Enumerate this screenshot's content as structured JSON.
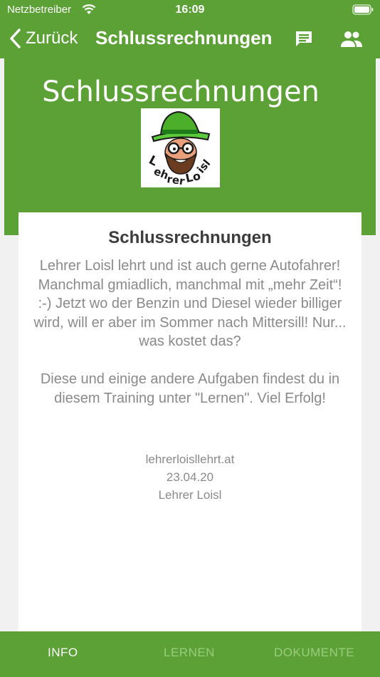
{
  "status_bar": {
    "carrier": "Netzbetreiber",
    "time": "16:09",
    "wifi_icon": "wifi-icon",
    "battery_icon": "battery-icon"
  },
  "nav": {
    "back_label": "Zurück",
    "title": "Schlussrechnungen",
    "icons": [
      "chevron-left-icon",
      "chat-icon",
      "people-icon"
    ]
  },
  "banner": {
    "title": "Schlussrechnungen",
    "logo_text": "Lehrer Loisl"
  },
  "card": {
    "title": "Schlussrechnungen",
    "body": "Lehrer Loisl lehrt und ist auch gerne Autofahrer! Manchmal gmiadlich, manchmal mit „mehr Zeit“! :-) Jetzt wo der Benzin und Diesel wieder billiger wird, will er aber im Sommer nach Mittersill! Nur... was kostet das?\n\nDiese und einige andere Aufgaben findest du in diesem Training unter \"Lernen\". Viel Erfolg!",
    "website": "lehrerloisllehrt.at",
    "date": "23.04.20",
    "author": "Lehrer Loisl"
  },
  "tabs": {
    "info": "INFO",
    "lernen": "LERNEN",
    "dokumente": "DOKUMENTE",
    "active": "INFO"
  },
  "colors": {
    "brand_green": "#5ca136",
    "inactive_tab": "#9ccb80",
    "background": "#f1f1f2"
  }
}
